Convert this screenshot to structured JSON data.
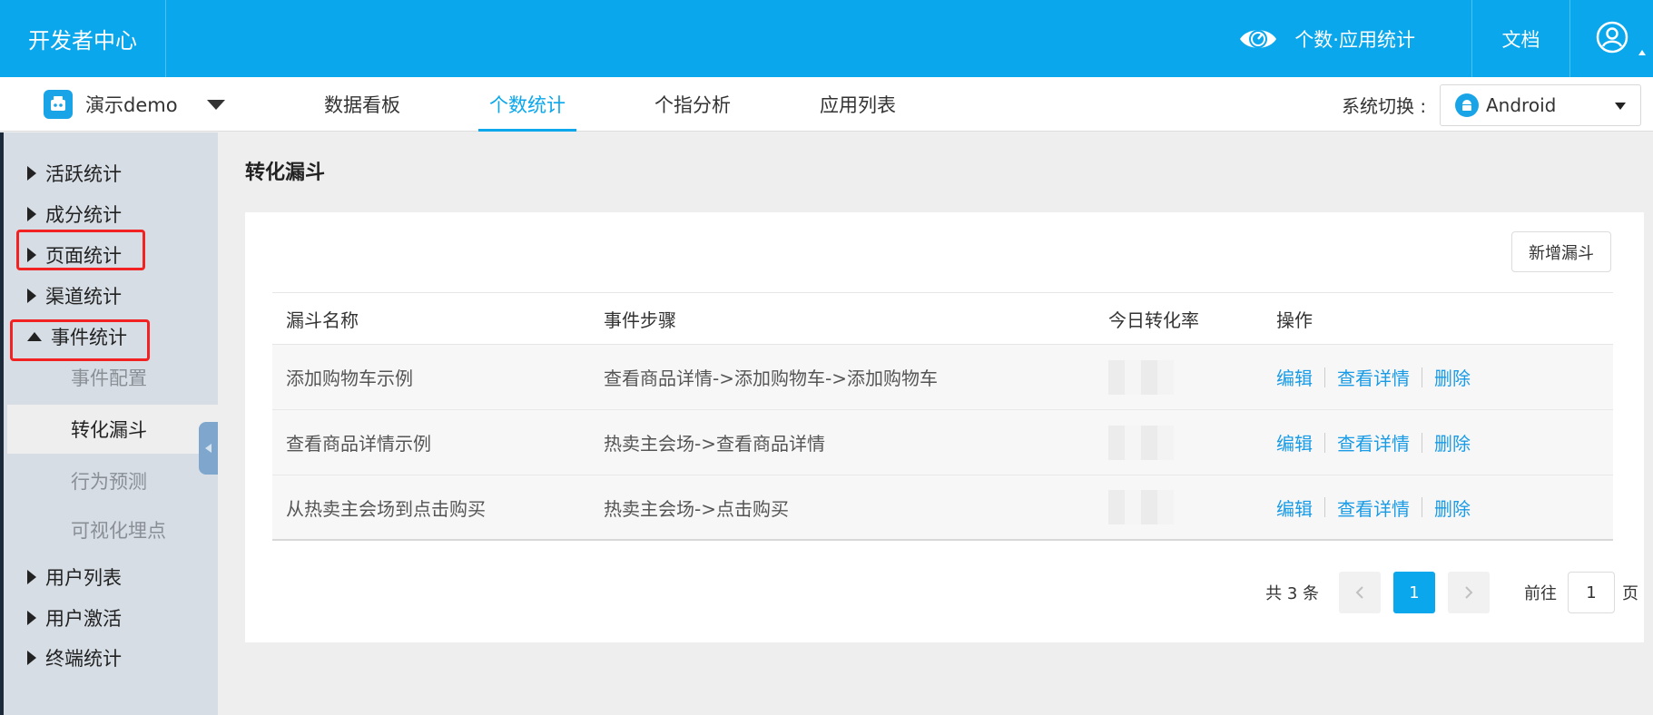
{
  "header": {
    "brand": "开发者中心",
    "product_name": "个数·应用统计",
    "docs_label": "文档",
    "eye_icon": "eye-icon",
    "user_icon": "user-icon"
  },
  "navbar": {
    "app_name": "演示demo",
    "tabs": [
      {
        "label": "数据看板",
        "active": false
      },
      {
        "label": "个数统计",
        "active": true
      },
      {
        "label": "个指分析",
        "active": false
      },
      {
        "label": "应用列表",
        "active": false
      }
    ],
    "system_switch_label": "系统切换 :",
    "system_value": "Android"
  },
  "sidebar": {
    "items": [
      {
        "label": "活跃统计",
        "expanded": false
      },
      {
        "label": "成分统计",
        "expanded": false
      },
      {
        "label": "页面统计",
        "expanded": false
      },
      {
        "label": "渠道统计",
        "expanded": false
      },
      {
        "label": "事件统计",
        "expanded": true
      },
      {
        "label": "用户列表",
        "expanded": false
      },
      {
        "label": "用户激活",
        "expanded": false
      },
      {
        "label": "终端统计",
        "expanded": false
      }
    ],
    "sub_items": [
      {
        "label": "事件配置",
        "active": false
      },
      {
        "label": "转化漏斗",
        "active": true
      },
      {
        "label": "行为预测",
        "active": false
      },
      {
        "label": "可视化埋点",
        "active": false
      }
    ],
    "highlight_color": "#f22222"
  },
  "main": {
    "title": "转化漏斗",
    "add_button": "新增漏斗",
    "columns": [
      "漏斗名称",
      "事件步骤",
      "今日转化率",
      "操作"
    ],
    "rows": [
      {
        "name": "添加购物车示例",
        "steps": "查看商品详情->添加购物车->添加购物车"
      },
      {
        "name": "查看商品详情示例",
        "steps": "热卖主会场->查看商品详情"
      },
      {
        "name": "从热卖主会场到点击购买",
        "steps": "热卖主会场->点击购买"
      }
    ],
    "actions": {
      "edit": "编辑",
      "detail": "查看详情",
      "delete": "删除"
    },
    "pagination": {
      "total_text": "共 3 条",
      "current_page": "1",
      "goto_label": "前往",
      "goto_value": "1",
      "page_unit": "页"
    }
  },
  "colors": {
    "brand_blue": "#0aa7ec",
    "link_blue": "#1a9be6",
    "sidebar_bg": "#d6dde5"
  }
}
